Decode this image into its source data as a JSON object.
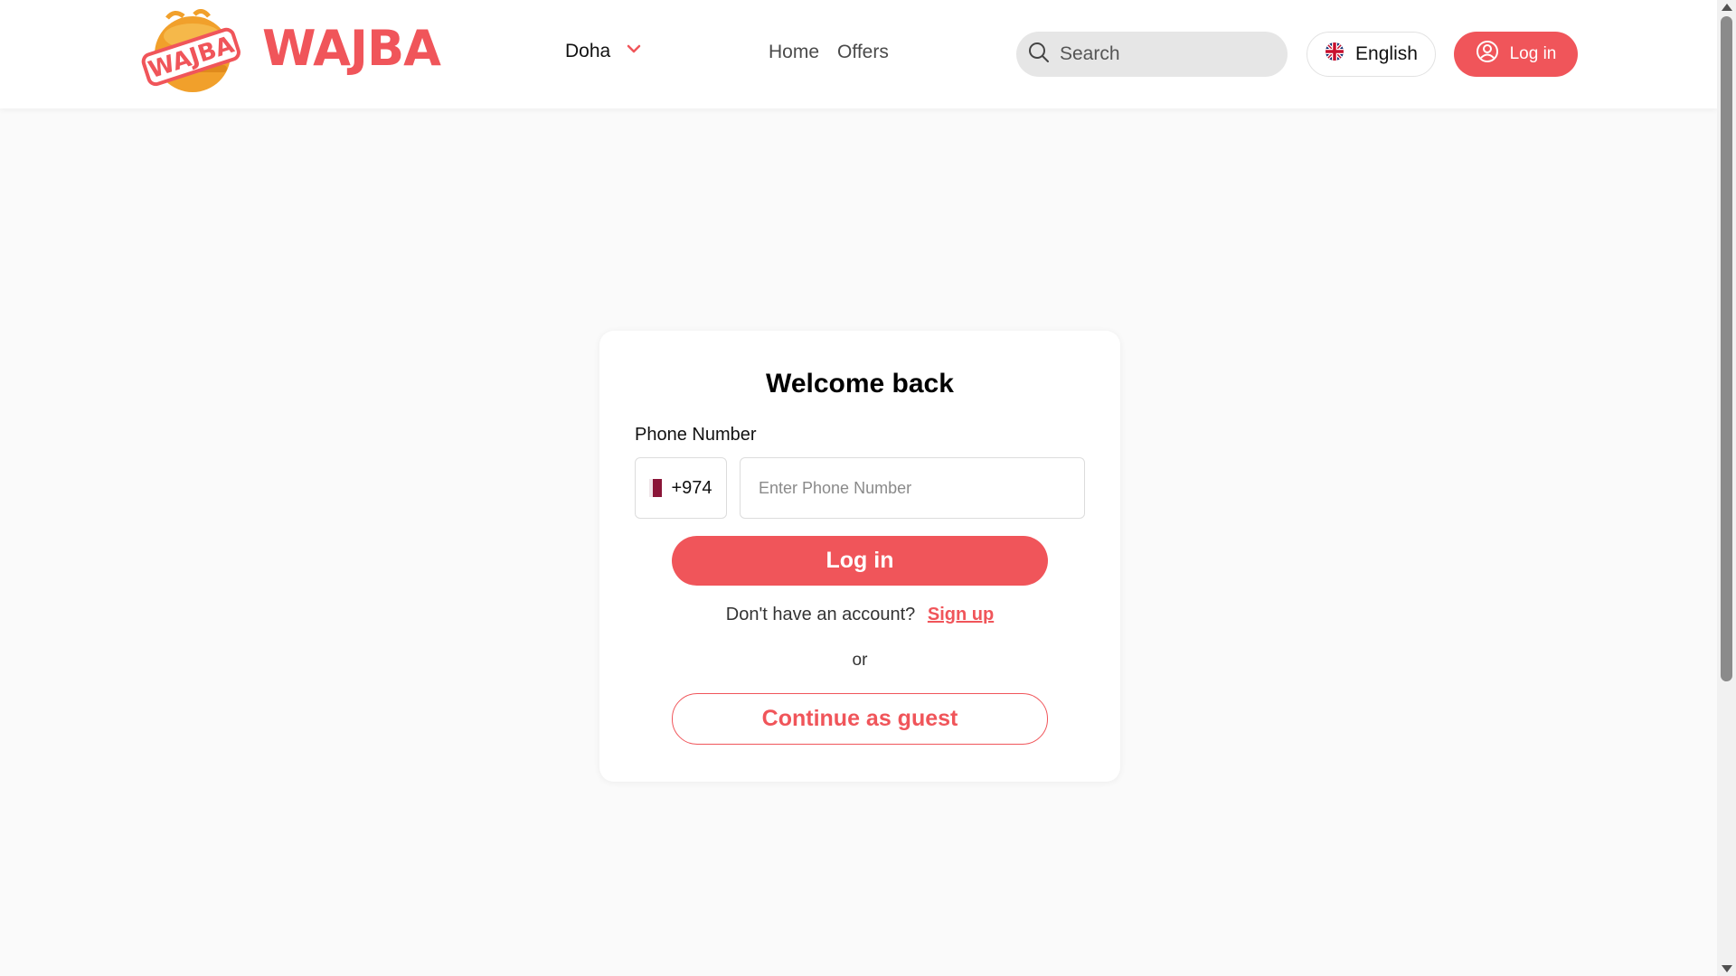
{
  "header": {
    "logo_text": "WAJBA",
    "badge_text": "WAJBA",
    "city": "Doha",
    "nav": [
      "Home",
      "Offers"
    ],
    "search_placeholder": "Search",
    "language": "English",
    "login_label": "Log in"
  },
  "login_card": {
    "title": "Welcome back",
    "phone_label": "Phone Number",
    "country_code": "+974",
    "phone_placeholder": "Enter Phone Number",
    "login_button": "Log in",
    "no_account_text": "Don't have an account?",
    "signup_link": "Sign up",
    "or_text": "or",
    "guest_button": "Continue as guest"
  },
  "colors": {
    "brand": "#f0555a",
    "qatar_maroon": "#8a1538",
    "search_bg": "#e6e6e6"
  },
  "icons": {
    "logo": "wajba-burger-badge-icon",
    "city_dropdown": "chevron-down-icon",
    "search": "search-icon",
    "language": "uk-flag-icon",
    "login": "user-circle-icon",
    "country": "qatar-flag-icon"
  }
}
